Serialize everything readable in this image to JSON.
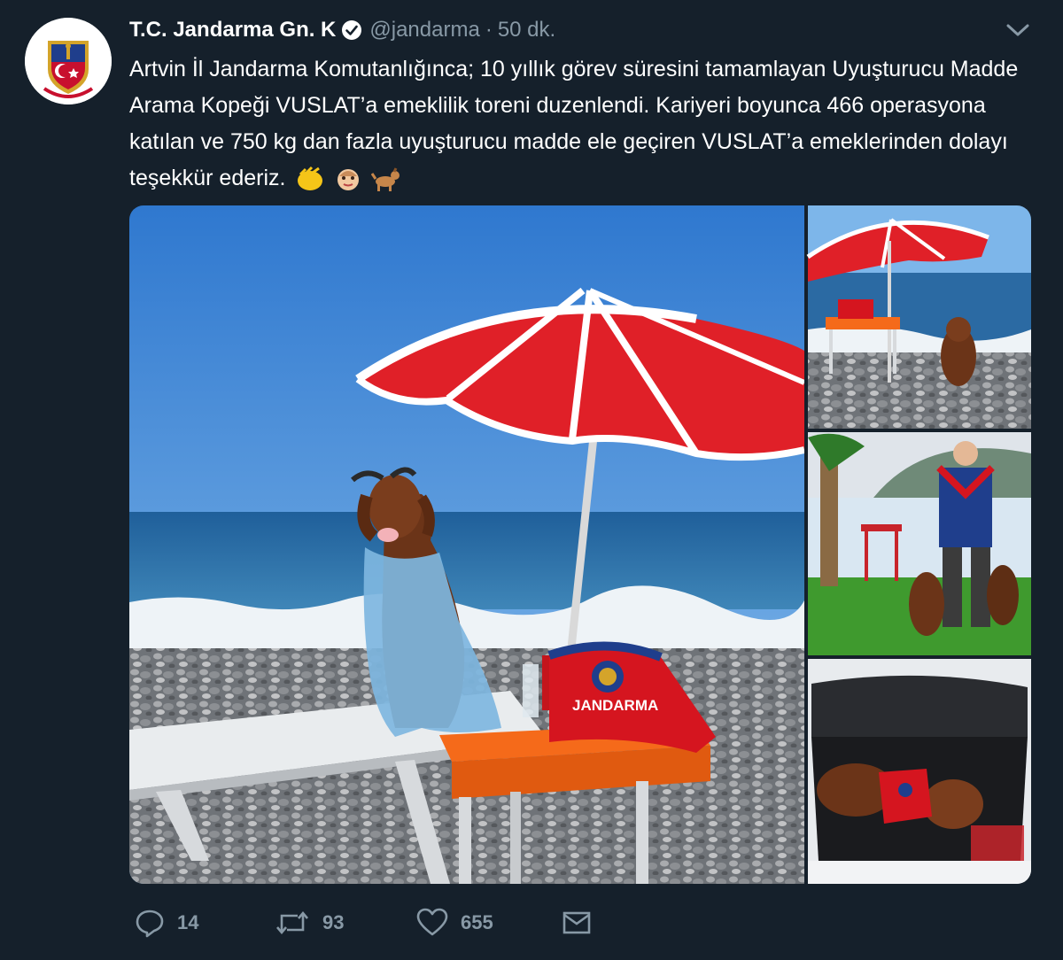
{
  "tweet": {
    "author_name": "T.C. Jandarma Gn. K",
    "handle": "@jandarma",
    "separator": "·",
    "time": "50 dk.",
    "text": "Artvin İl Jandarma Komutanlığınca; 10 yıllık görev süresini tamamlayan Uyuşturucu Madde Arama Kopeği VUSLAT’a emeklilik toreni duzenlendi. Kariyeri boyunca 466 operasyona katılan ve 750 kg dan fazla uyuşturucu madde ele geçiren VUSLAT’a emeklerinden dolayı teşekkür ederiz.",
    "emojis": [
      "clapping-hands-emoji",
      "baby-face-emoji",
      "dog-emoji"
    ],
    "vest_label": "JANDARMA",
    "replies": "14",
    "retweets": "93",
    "likes": "655"
  },
  "colors": {
    "background": "#15202b",
    "secondary_text": "#8899a6",
    "verified_badge": "#ffffff",
    "umbrella_red": "#e02028",
    "table_orange": "#f56a1a",
    "sky_blue": "#4a8fd8",
    "sea_blue": "#2f6ea8"
  },
  "icons": {
    "verified": "verified-badge-icon",
    "more": "chevron-down-icon",
    "reply": "reply-icon",
    "retweet": "retweet-icon",
    "like": "heart-icon",
    "dm": "envelope-icon"
  }
}
